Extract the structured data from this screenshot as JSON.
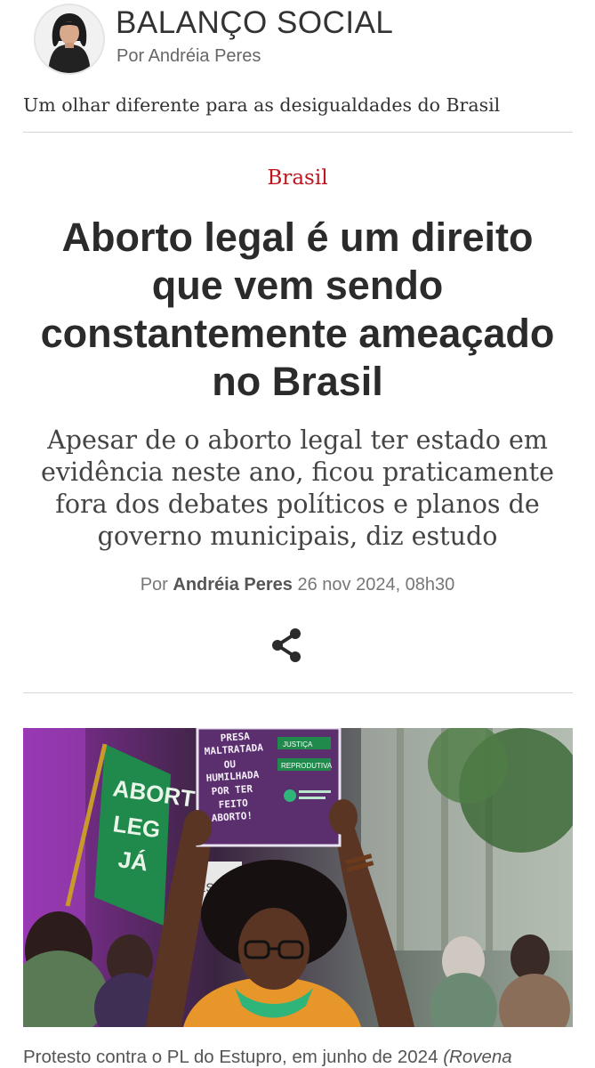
{
  "blog": {
    "title": "BALANÇO SOCIAL",
    "author_line": "Por Andréia Peres",
    "tagline": "Um olhar diferente para as desigualdades do Brasil"
  },
  "article": {
    "section": "Brasil",
    "headline_lines": [
      "Aborto legal é um direito",
      "que vem sendo",
      "constantemente ameaçado",
      "no Brasil"
    ],
    "subhead_lines": [
      "Apesar de o aborto legal ter estado em",
      "evidência neste ano, ficou praticamente",
      "fora dos debates políticos e planos de",
      "governo municipais, diz estudo"
    ],
    "byline": {
      "prefix": "Por",
      "author": "Andréia Peres",
      "date": "26 nov 2024, 08h30"
    },
    "share_icon": "share-icon",
    "photo": {
      "sign_lines": [
        "PRESA",
        "MALTRATADA",
        "OU",
        "HUMILHADA",
        "POR TER",
        "FEITO",
        "ABORTO!"
      ],
      "sign_tags": [
        "JUSTIÇA",
        "REPRODUTIVA"
      ],
      "flag_lines": [
        "ABORT",
        "LEG",
        "JÁ"
      ],
      "building_text": "ESP"
    },
    "caption": {
      "text": "Protesto contra o PL do Estupro, em junho de 2024",
      "credit": "(Rovena"
    }
  },
  "colors": {
    "accent_red": "#c0141c",
    "flag_green": "#1f8a4c",
    "sign_purple": "#5b2e6e"
  }
}
